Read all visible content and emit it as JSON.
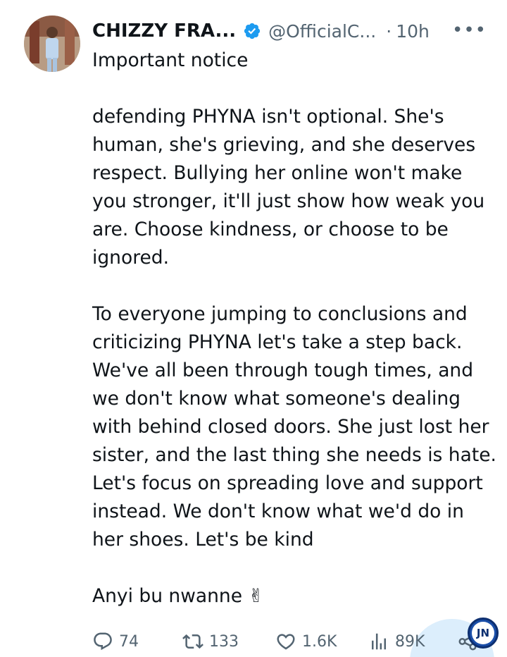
{
  "tweet": {
    "display_name": "CHIZZY FRA...",
    "handle": "@OfficialC...",
    "separator": "·",
    "time": "10h",
    "more_icon": "more-horizontal-icon",
    "verified_color": "#1d9bf0",
    "paragraphs": [
      "Important notice",
      "",
      "defending PHYNA isn't optional. She's human, she's grieving, and she deserves respect. Bullying her online won't make you stronger, it'll just show how weak you are. Choose kindness, or choose to be ignored.",
      "",
      "To everyone jumping to conclusions and criticizing PHYNA  let's take a step back. We've all been through tough times, and we don't know what someone's dealing with behind closed doors. She just lost her sister, and the last thing she needs is hate. Let's focus on spreading love and support instead. We don't know what we'd do in her shoes. Let's be kind",
      "",
      "Anyi bu nwanne ✌"
    ]
  },
  "actions": {
    "replies": "74",
    "retweets": "133",
    "likes": "1.6K",
    "views": "89K"
  },
  "watermark": {
    "logo_text": "JN"
  }
}
